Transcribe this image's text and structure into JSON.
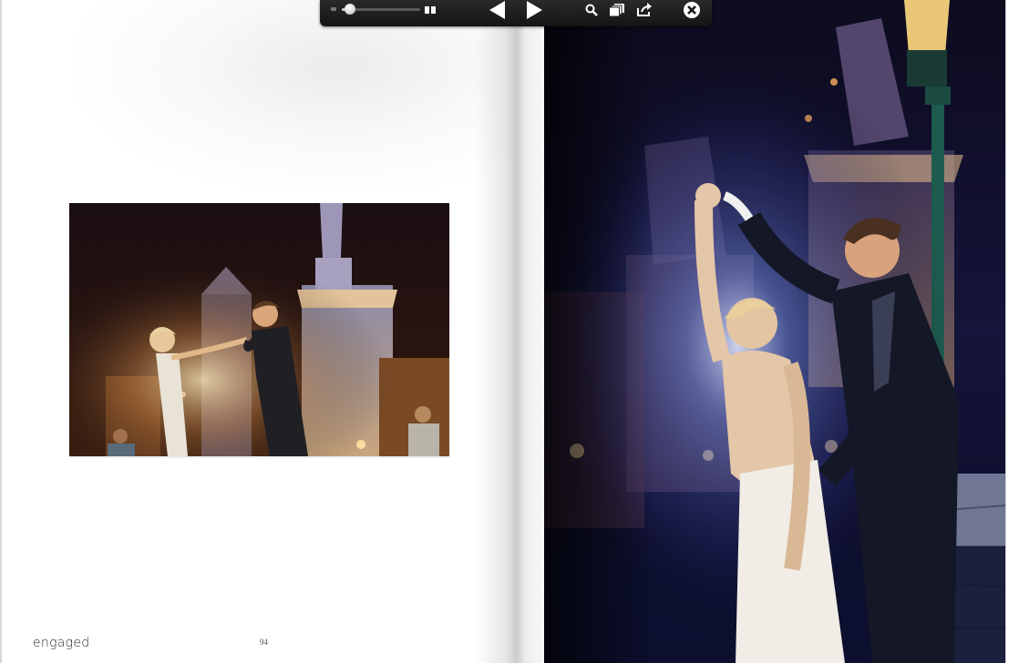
{
  "left_page": {
    "footer_title": "engaged",
    "page_number": "94"
  },
  "photos": {
    "left_photo": "couple-night-hand-kiss-photo",
    "right_photo": "couple-dancing-bridge-night-photo"
  },
  "toolbar": {
    "zoom_level": 0.1,
    "icons": {
      "zoom_min": "small-page-icon",
      "zoom_max": "two-page-icon",
      "prev": "triangle-left-icon",
      "next": "triangle-right-icon",
      "search": "magnifier-icon",
      "bookmarks": "bookmarks-icon",
      "share": "share-arrow-icon",
      "close": "close-circle-icon"
    }
  },
  "colors": {
    "toolbar_bg": "#1d1d1d",
    "toolbar_icon": "#ffffff",
    "night_sky": "#0c0d22"
  }
}
